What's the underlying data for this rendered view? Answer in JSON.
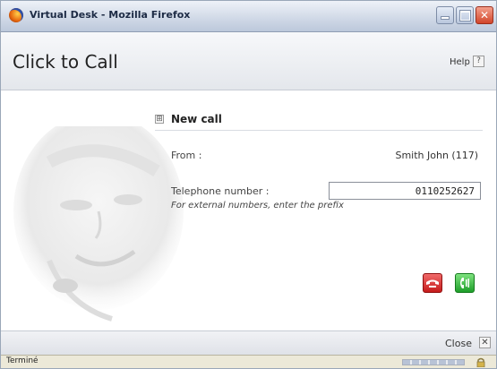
{
  "window": {
    "title": "Virtual Desk - Mozilla Firefox",
    "icon": "firefox-icon",
    "controls": [
      "minimize-icon",
      "maximize-icon",
      "close-icon"
    ]
  },
  "header": {
    "title": "Click to Call",
    "help_label": "Help",
    "help_icon_glyph": "?"
  },
  "new_call": {
    "expand_glyph": "⊞",
    "title": "New call",
    "from_label": "From :",
    "from_value": "Smith John (117)",
    "telephone_label": "Telephone number :",
    "telephone_value": "0110252627",
    "hint": "For external numbers, enter the prefix",
    "hangup_icon": "hangup-phone-icon",
    "dial_icon": "dial-phone-icon"
  },
  "footer": {
    "close_label": "Close",
    "close_glyph": "✕"
  },
  "statusbar": {
    "text": "Terminé",
    "lock_icon": "lock-icon"
  },
  "colors": {
    "hangup": "#c61b1b",
    "dial": "#1e9e2a",
    "title_bar": "#cfd8e6"
  }
}
